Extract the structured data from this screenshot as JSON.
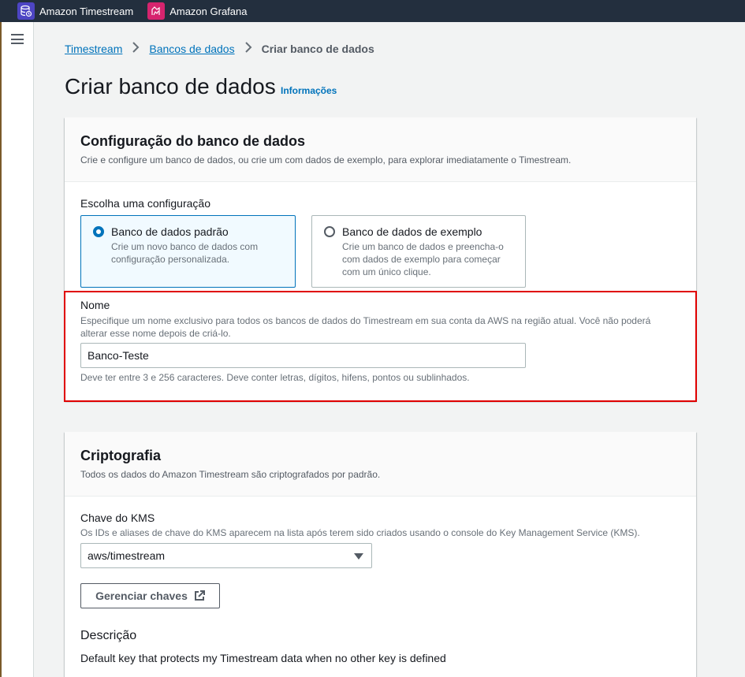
{
  "favorites": [
    {
      "label": "Amazon Timestream",
      "icon": "timestream-icon"
    },
    {
      "label": "Amazon Grafana",
      "icon": "grafana-icon"
    }
  ],
  "breadcrumb": {
    "items": [
      "Timestream",
      "Bancos de dados"
    ],
    "current": "Criar banco de dados"
  },
  "page": {
    "title": "Criar banco de dados",
    "info_link": "Informações"
  },
  "config_panel": {
    "title": "Configuração do banco de dados",
    "description": "Crie e configure um banco de dados, ou crie um com dados de exemplo, para explorar imediatamente o Timestream.",
    "choose_label": "Escolha uma configuração",
    "options": [
      {
        "label": "Banco de dados padrão",
        "desc1": "Crie um novo banco de dados com",
        "desc2": "configuração personalizada.",
        "desc3": "",
        "selected": true
      },
      {
        "label": "Banco de dados de exemplo",
        "desc1": "Crie um banco de dados e preencha-o",
        "desc2": "com dados de exemplo para começar",
        "desc3": "com um único clique.",
        "selected": false
      }
    ],
    "name_label": "Nome",
    "name_desc1": "Especifique um nome exclusivo para todos os bancos de dados do Timestream em sua conta da AWS na região atual. Você não poderá",
    "name_desc2": "alterar esse nome depois de criá-lo.",
    "name_value": "Banco-Teste",
    "name_constraint": "Deve ter entre 3 e 256 caracteres. Deve conter letras, dígitos, hifens, pontos ou sublinhados."
  },
  "encryption_panel": {
    "title": "Criptografia",
    "description": "Todos os dados do Amazon Timestream são criptografados por padrão.",
    "kms_label": "Chave do KMS",
    "kms_desc": "Os IDs e aliases de chave do KMS aparecem na lista após terem sido criados usando o console do Key Management Service (KMS).",
    "kms_value": "aws/timestream",
    "manage_keys_label": "Gerenciar chaves",
    "description_label": "Descrição",
    "description_value": "Default key that protects my Timestream data when no other key is defined"
  },
  "colors": {
    "link": "#0073bb",
    "highlight": "#e00000",
    "topbar": "#232f3e"
  }
}
